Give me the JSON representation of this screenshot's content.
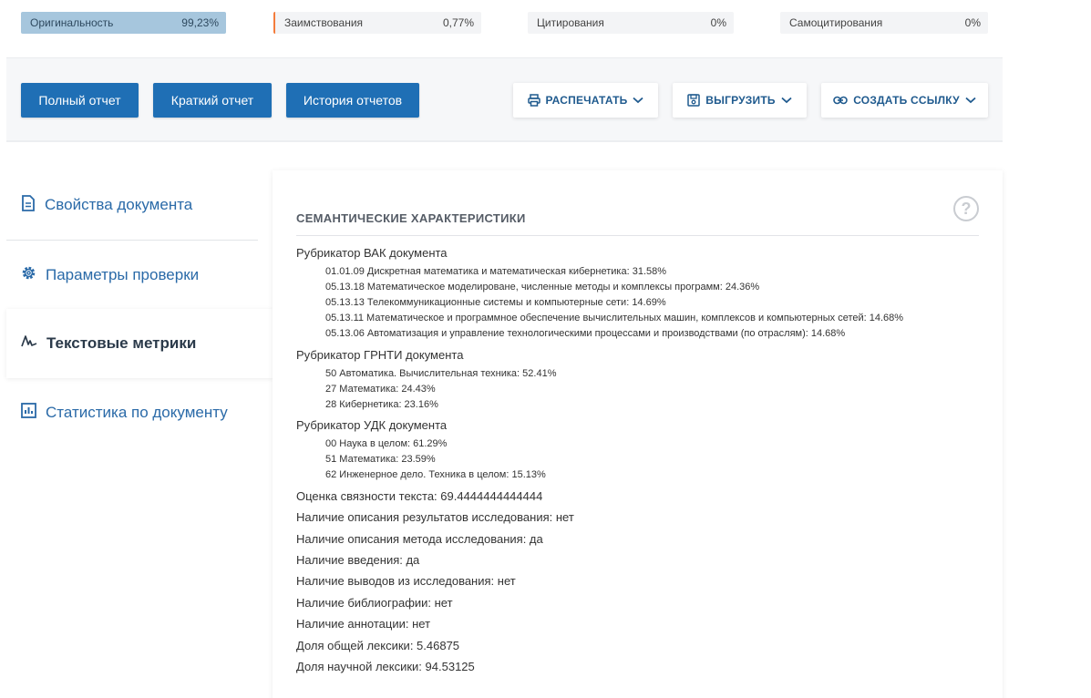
{
  "metrics": {
    "originality": {
      "label": "Оригинальность",
      "value": "99,23%"
    },
    "borrowing": {
      "label": "Заимствования",
      "value": "0,77%"
    },
    "citing": {
      "label": "Цитирования",
      "value": "0%"
    },
    "self_citing": {
      "label": "Самоцитирования",
      "value": "0%"
    }
  },
  "buttons": {
    "full_report": "Полный отчет",
    "short_report": "Краткий отчет",
    "history": "История отчетов",
    "print": "РАСПЕЧАТАТЬ",
    "export": "ВЫГРУЗИТЬ",
    "create_link": "СОЗДАТЬ ССЫЛКУ"
  },
  "sidebar": {
    "items": [
      {
        "label": "Свойства документа",
        "icon": "document-icon"
      },
      {
        "label": "Параметры проверки",
        "icon": "gear-icon"
      },
      {
        "label": "Текстовые метрики",
        "icon": "text-metrics-icon",
        "active": true
      },
      {
        "label": "Статистика по документу",
        "icon": "bar-chart-icon"
      }
    ]
  },
  "panel": {
    "title": "СЕМАНТИЧЕСКИЕ ХАРАКТЕРИСТИКИ",
    "help": "?",
    "vak": {
      "heading": "Рубрикатор ВАК документа",
      "items": [
        "01.01.09 Дискретная математика и математическая кибернетика: 31.58%",
        "05.13.18 Математическое моделироване, численные методы и комплексы программ: 24.36%",
        "05.13.13 Телекоммуникационные системы и компьютерные сети: 14.69%",
        "05.13.11 Математическое и программное обеспечение вычислительных машин, комплексов и компьютерных сетей: 14.68%",
        "05.13.06 Автоматизация и управление технологическими процессами и производствами (по отраслям): 14.68%"
      ]
    },
    "grnti": {
      "heading": "Рубрикатор ГРНТИ документа",
      "items": [
        "50 Автоматика. Вычислительная техника: 52.41%",
        "27 Математика: 24.43%",
        "28 Кибернетика: 23.16%"
      ]
    },
    "udk": {
      "heading": "Рубрикатор УДК документа",
      "items": [
        "00 Наука в целом: 61.29%",
        "51 Математика: 23.59%",
        "62 Инженерное дело. Техника в целом: 15.13%"
      ]
    },
    "props": [
      "Оценка связности текста: 69.4444444444444",
      "Наличие описания результатов исследования: нет",
      "Наличие описания метода исследования: да",
      "Наличие введения: да",
      "Наличие выводов из исследования: нет",
      "Наличие библиографии: нет",
      "Наличие аннотации: нет",
      "Доля общей лексики: 5.46875",
      "Доля научной лексики: 94.53125"
    ]
  }
}
